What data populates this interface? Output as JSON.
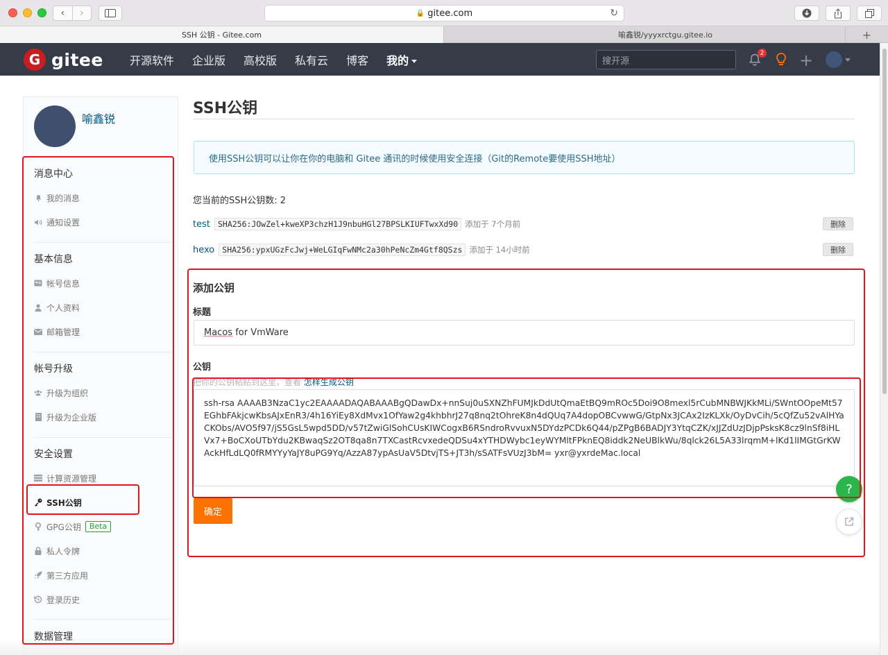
{
  "browser": {
    "url": "gitee.com",
    "tabs": [
      {
        "label": "SSH 公钥 - Gitee.com",
        "active": true
      },
      {
        "label": "喻鑫锐/yyyxrctgu.gitee.io",
        "active": false
      }
    ],
    "new_tab": "+"
  },
  "header": {
    "logo_letter": "G",
    "logo_text": "gitee",
    "nav": [
      "开源软件",
      "企业版",
      "高校版",
      "私有云",
      "博客",
      "我的"
    ],
    "search_placeholder": "搜开源",
    "notification_count": "2",
    "plus": "+"
  },
  "sidebar": {
    "username": "喻鑫锐",
    "sections": [
      {
        "title": "消息中心",
        "items": [
          {
            "icon": "bell-icon",
            "label": "我的消息"
          },
          {
            "icon": "speaker-icon",
            "label": "通知设置"
          }
        ]
      },
      {
        "title": "基本信息",
        "items": [
          {
            "icon": "id-card-icon",
            "label": "帐号信息"
          },
          {
            "icon": "person-icon",
            "label": "个人资料"
          },
          {
            "icon": "envelope-icon",
            "label": "邮箱管理"
          }
        ]
      },
      {
        "title": "帐号升级",
        "items": [
          {
            "icon": "group-icon",
            "label": "升级为组织"
          },
          {
            "icon": "building-icon",
            "label": "升级为企业版"
          }
        ]
      },
      {
        "title": "安全设置",
        "items": [
          {
            "icon": "server-icon",
            "label": "计算资源管理"
          },
          {
            "icon": "key-icon",
            "label": "SSH公钥"
          },
          {
            "icon": "gpg-key-icon",
            "label": "GPG公钥",
            "badge": "Beta"
          },
          {
            "icon": "lock-icon",
            "label": "私人令牌"
          },
          {
            "icon": "rocket-icon",
            "label": "第三方应用"
          },
          {
            "icon": "history-icon",
            "label": "登录历史"
          }
        ]
      },
      {
        "title": "数据管理",
        "items": []
      }
    ]
  },
  "main": {
    "title": "SSH公钥",
    "info": "使用SSH公钥可以让你在你的电脑和 Gitee 通讯的时候使用安全连接（Git的Remote要使用SSH地址）",
    "count_label": "您当前的SSH公钥数: 2",
    "keys": [
      {
        "name": "test",
        "fingerprint": "SHA256:JOwZel+kweXP3chzH1J9nbuHGl27BPSLKIUFTwxXd90",
        "added": "添加于 7个月前",
        "delete_label": "删除"
      },
      {
        "name": "hexo",
        "fingerprint": "SHA256:ypxUGzFcJwj+WeLGIqFwNMc2a30hPeNcZm4Gtf8QSzs",
        "added": "添加于 14小时前",
        "delete_label": "删除"
      }
    ],
    "add_section": {
      "heading": "添加公钥",
      "title_label": "标题",
      "title_value_word": "Macos",
      "title_value_rest": " for VmWare",
      "key_label": "公钥",
      "hint_prefix": "把你的公钥粘贴到这里，查看 ",
      "hint_link": "怎样生成公钥",
      "key_value": "ssh-rsa AAAAB3NzaC1yc2EAAAADAQABAAABgQDawDx+nnSuj0uSXNZhFUMJkDdUtQmaEtBQ9mROc5Doi9O8mexl5rCubMNBWJKkMLi/SWntOOpeMt57EGhbFAkjcwKbsAJxEnR3/4h16YiEy8XdMvx1OfYaw2g4khbhrJ27q8nq2tOhreK8n4dQUq7A4dopOBCvwwG/GtpNx3JCAx2IzKLXk/OyDvCih/5cQfZu52vAlHYaCKObs/AVO5f97/jS5GsL5wpd5DD/v57tZwiGlSohCUsKIWCogxB6RSndroRvvuxN5DYdzPCDk6Q44/pZPgB6BADJY3YtqCZK/xJJZdUzJDjpPsksK8cz9lnSf8iHLVx7+BoCXoUTbYdu2KBwaqSz2OT8qa8n7TXCastRcvxedeQDSu4xYTHDWybc1eyWYMltFPknEQ8iddk2NeUBlkWu/8qlck26L5A33lrqmM+lKd1lIMGtGrKWAckHfLdLQ0fRMYYyYaJY8uPG9Yq/AzzA87ypAsUaV5DtvjTS+JT3h/sSATFsVUzJ3bM= yxr@yxrdeMac.local",
      "submit_label": "确定"
    }
  },
  "floating": {
    "help": "?"
  },
  "colors": {
    "header_bg": "#353c48",
    "brand_red": "#c71d23",
    "primary_orange": "#fe7300",
    "link_blue": "#005980",
    "annotation_red": "#e1141b"
  }
}
